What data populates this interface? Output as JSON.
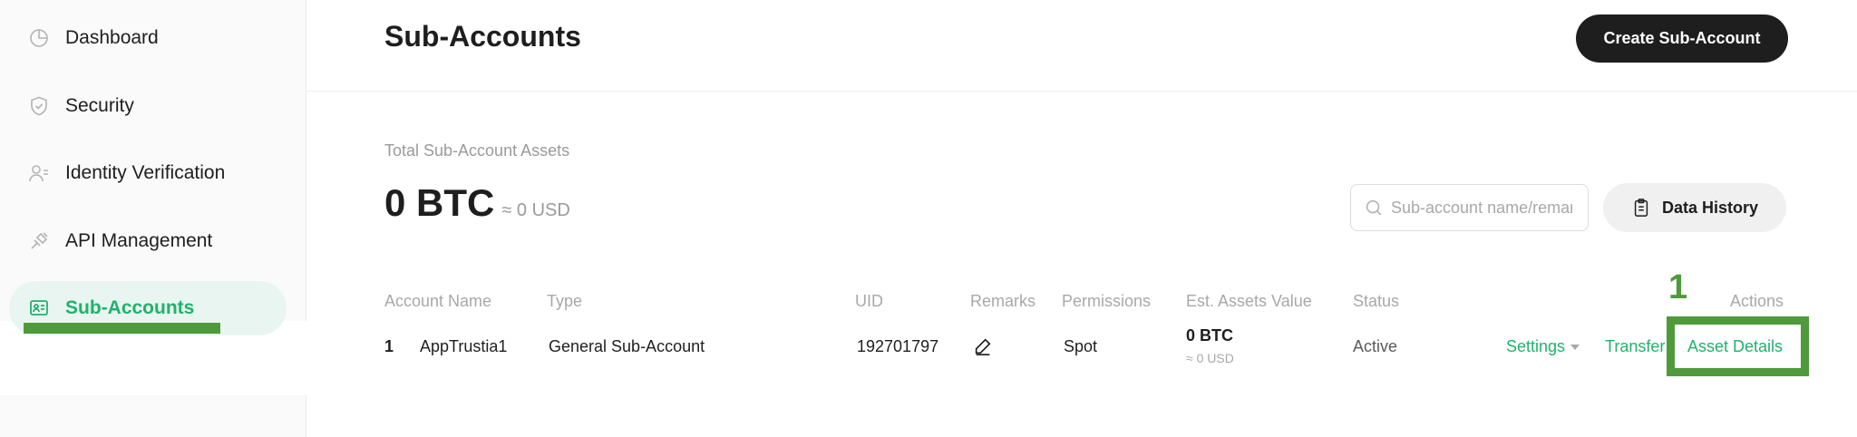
{
  "sidebar": {
    "items": [
      {
        "label": "Dashboard",
        "icon": "dashboard-icon"
      },
      {
        "label": "Security",
        "icon": "shield-icon"
      },
      {
        "label": "Identity Verification",
        "icon": "user-id-icon"
      },
      {
        "label": "API Management",
        "icon": "plug-icon"
      },
      {
        "label": "Sub-Accounts",
        "icon": "sub-accounts-icon",
        "active": true
      }
    ]
  },
  "header": {
    "title": "Sub-Accounts",
    "create_button": "Create Sub-Account"
  },
  "summary": {
    "label": "Total Sub-Account Assets",
    "btc": "0 BTC",
    "usd": "≈ 0 USD"
  },
  "search": {
    "placeholder": "Sub-account name/remarks"
  },
  "data_history_button": "Data History",
  "table": {
    "headers": [
      "Account Name",
      "Type",
      "UID",
      "Remarks",
      "Permissions",
      "Est. Assets Value",
      "Status",
      "Actions"
    ],
    "rows": [
      {
        "index": "1",
        "account_name": "AppTrustia1",
        "type": "General Sub-Account",
        "uid": "192701797",
        "permissions": "Spot",
        "assets_btc": "0 BTC",
        "assets_usd": "≈ 0 USD",
        "status": "Active",
        "actions": [
          "Settings",
          "Transfer",
          "Asset Details"
        ]
      }
    ]
  },
  "annotation": {
    "number": "1"
  },
  "colors": {
    "accent": "#20b26c",
    "annotation": "#4f9a3a",
    "primary_button": "#1e1e1e"
  }
}
